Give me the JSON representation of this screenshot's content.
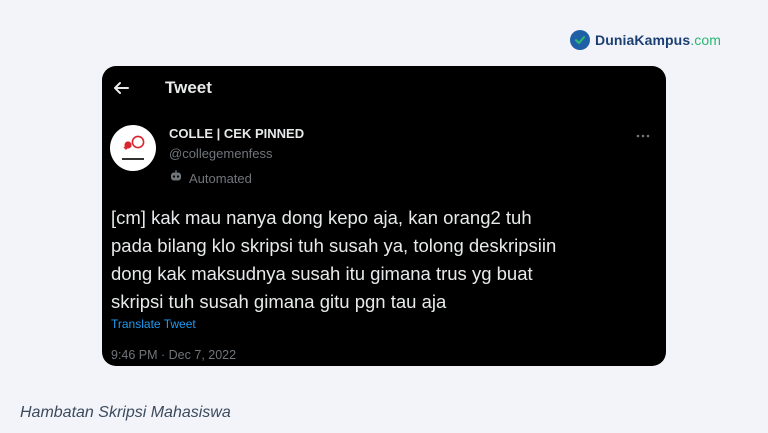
{
  "brand": {
    "name": "DuniaKampus",
    "suffix": ".com",
    "accent": "#1f5fa8",
    "accent_secondary": "#2bb673"
  },
  "tweet_page": {
    "title": "Tweet",
    "author": {
      "display_name": "COLLE | CEK PINNED",
      "handle": "@collegemenfess",
      "label": "Automated"
    },
    "body": "[cm] kak mau nanya dong kepo aja, kan orang2 tuh\npada bilang klo skripsi tuh susah ya, tolong deskripsiin\ndong kak maksudnya susah itu gimana trus yg buat\nskripsi tuh susah gimana gitu pgn tau aja",
    "translate_label": "Translate Tweet",
    "timestamp": "9:46 PM · Dec 7, 2022",
    "icons": {
      "back": "back-arrow-icon",
      "more": "more-options-icon",
      "automated": "bot-icon"
    },
    "colors": {
      "background": "#000000",
      "text": "#e7e9ea",
      "secondary": "#71767b",
      "link": "#1d9bf0"
    }
  },
  "caption": "Hambatan Skripsi Mahasiswa"
}
